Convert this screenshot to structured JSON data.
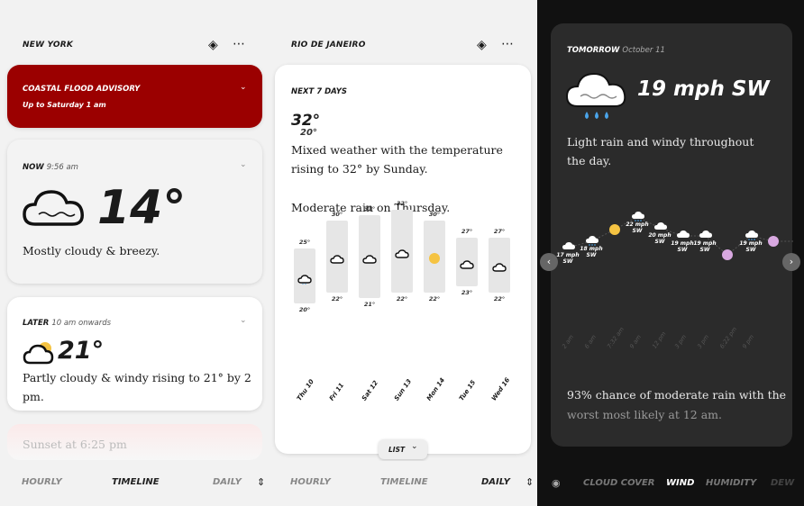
{
  "left": {
    "city": "NEW YORK",
    "advisory": {
      "title": "COASTAL FLOOD ADVISORY",
      "subtitle": "Up to Saturday 1 am"
    },
    "now": {
      "label": "NOW",
      "time": "9:56 am",
      "temp": "14°",
      "desc": "Mostly cloudy & breezy."
    },
    "later": {
      "label": "LATER",
      "time": "10 am onwards",
      "temp": "21°",
      "desc": "Partly cloudy & windy rising to 21° by 2 pm."
    },
    "sunset": "Sunset at 6:25 pm",
    "tabs": [
      "HOURLY",
      "TIMELINE",
      "DAILY"
    ]
  },
  "middle": {
    "city": "RIO DE JANEIRO",
    "heading": "NEXT 7 DAYS",
    "high": "32°",
    "low": "20°",
    "summary": "Mixed weather with the temperature rising to 32°  by Sunday.",
    "rain": "Moderate rain on Thursday.",
    "days": [
      {
        "label": "Thu 10",
        "high": "25°",
        "low": "20°",
        "icon": "cloud-rain"
      },
      {
        "label": "Fri 11",
        "high": "30°",
        "low": "22°",
        "icon": "cloud"
      },
      {
        "label": "Sat 12",
        "high": "31°",
        "low": "21°",
        "icon": "cloud"
      },
      {
        "label": "Sun 13",
        "high": "32°",
        "low": "22°",
        "icon": "cloud"
      },
      {
        "label": "Mon 14",
        "high": "30°",
        "low": "22°",
        "icon": "sun"
      },
      {
        "label": "Tue 15",
        "high": "27°",
        "low": "23°",
        "icon": "cloud"
      },
      {
        "label": "Wed 16",
        "high": "27°",
        "low": "22°",
        "icon": "cloud"
      }
    ],
    "list_button": "LIST",
    "tabs": [
      "HOURLY",
      "TIMELINE",
      "DAILY"
    ]
  },
  "right": {
    "label": "TOMORROW",
    "date": "October 11",
    "wind": "19 mph SW",
    "desc": "Light rain and windy throughout the day.",
    "points": [
      {
        "speed": "17 mph",
        "dir": "SW",
        "icon": "cloud"
      },
      {
        "speed": "18 mph",
        "dir": "SW",
        "icon": "cloud-rain"
      },
      {
        "speed": "",
        "dir": "",
        "icon": "sunrise"
      },
      {
        "speed": "22 mph",
        "dir": "SW",
        "icon": "cloud-rain"
      },
      {
        "speed": "20 mph",
        "dir": "SW",
        "icon": "cloud"
      },
      {
        "speed": "19 mph",
        "dir": "SW",
        "icon": "cloud"
      },
      {
        "speed": "19 mph",
        "dir": "SW",
        "icon": "cloud"
      },
      {
        "speed": "",
        "dir": "",
        "icon": "sunset"
      },
      {
        "speed": "19 mph",
        "dir": "SW",
        "icon": "cloud-rain"
      },
      {
        "speed": "",
        "dir": "",
        "icon": "moon"
      }
    ],
    "times": [
      "2 am",
      "6 am",
      "7:32 am",
      "9 am",
      "12 pm",
      "3 pm",
      "3 pm",
      "6:22 pm",
      "9 pm"
    ],
    "rain_text": "93% chance of moderate rain with the",
    "rain_text2": "worst most likely at 12 am.",
    "tabs": [
      "CLOUD COVER",
      "WIND",
      "HUMIDITY",
      "DEW"
    ]
  },
  "colors": {
    "advisory": "#9b0000",
    "sun": "#f5c342",
    "dark_bg": "#111111",
    "dark_card": "#2b2b2b"
  }
}
